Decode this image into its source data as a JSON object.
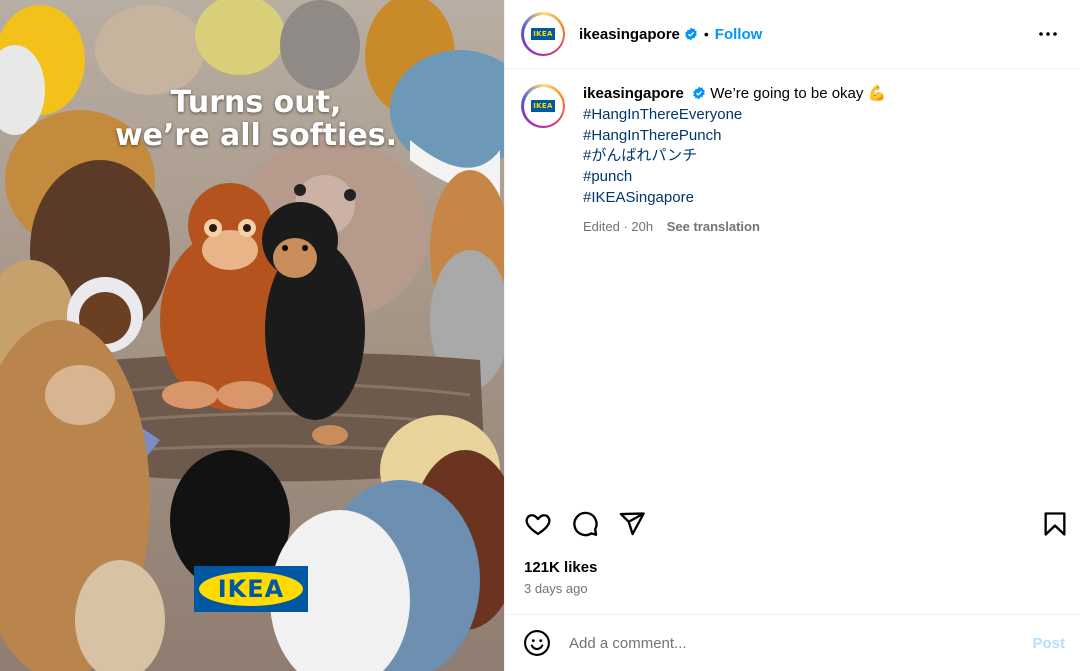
{
  "post": {
    "image_caption_line1": "Turns out,",
    "image_caption_line2": "we’re all softies.",
    "image_logo_text": "IKEA",
    "avatar_logo_text": "IKEA"
  },
  "header": {
    "username": "ikeasingapore",
    "dot": "•",
    "follow_label": "Follow",
    "icons": {
      "verified": "verified-badge-icon",
      "more": "more-options-icon"
    }
  },
  "caption": {
    "username": "ikeasingapore",
    "text": "We’re going to be okay 💪",
    "hashtags": [
      "#HangInThereEveryone",
      "#HangInTherePunch",
      "#がんばれパンチ",
      "#punch",
      "#IKEASingapore"
    ],
    "edited": "Edited · 20h",
    "see_translation": "See translation"
  },
  "actions": {
    "icons": [
      "heart-icon",
      "comment-icon",
      "share-icon",
      "bookmark-icon"
    ]
  },
  "stats": {
    "likes": "121K likes",
    "posted": "3 days ago"
  },
  "comment": {
    "placeholder": "Add a comment...",
    "post_label": "Post",
    "emoji_icon": "emoji-icon"
  },
  "colors": {
    "link": "#00376b",
    "follow": "#0095f6",
    "post_disabled": "#b2dffc",
    "ikea_blue": "#0058a3",
    "ikea_yellow": "#ffdb00",
    "verified": "#0095f6"
  }
}
